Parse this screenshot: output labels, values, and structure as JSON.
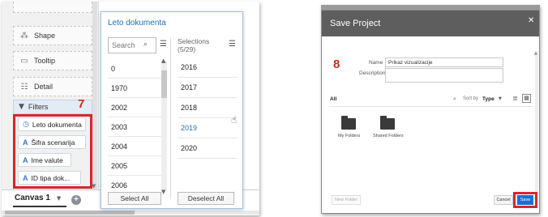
{
  "annotations": {
    "left_marker": "7",
    "right_marker": "8"
  },
  "grammar": {
    "shape_label": "Shape",
    "tooltip_label": "Tooltip",
    "detail_label": "Detail",
    "filters_label": "Filters",
    "filter_chips": [
      {
        "label": "Leto dokumenta",
        "icon": "clock-icon"
      },
      {
        "label": "Šifra scenarija",
        "icon": "A"
      },
      {
        "label": "Ime valute",
        "icon": "A"
      },
      {
        "label": "ID tipa dok...",
        "icon": "A"
      }
    ]
  },
  "canvas": {
    "tab_label": "Canvas 1"
  },
  "filter_popup": {
    "title": "Leto dokumenta",
    "search_placeholder": "Search",
    "selections_label": "Selections",
    "selections_count": "(5/29)",
    "years": [
      "0",
      "1970",
      "2002",
      "2003",
      "2004",
      "2005",
      "2006"
    ],
    "selected_years": [
      "2016",
      "2017",
      "2018",
      "2019",
      "2020"
    ],
    "highlighted_year": "2019",
    "select_all_label": "Select All",
    "deselect_all_label": "Deselect All"
  },
  "save_dialog": {
    "title": "Save Project",
    "name_label": "Name",
    "name_value": "Prikaz vizualizacije",
    "description_label": "Description",
    "description_value": "",
    "all_label": "All",
    "sort_by_label": "Sort by",
    "sort_by_value": "Type",
    "folders": [
      "My Folders",
      "Shared Folders"
    ],
    "new_folder_label": "New Folder",
    "cancel_label": "Cancel",
    "save_label": "Save"
  },
  "colors": {
    "accent_blue": "#1c6fd1",
    "highlight_red": "#d9262b",
    "header_gray": "#5e5e5e"
  }
}
